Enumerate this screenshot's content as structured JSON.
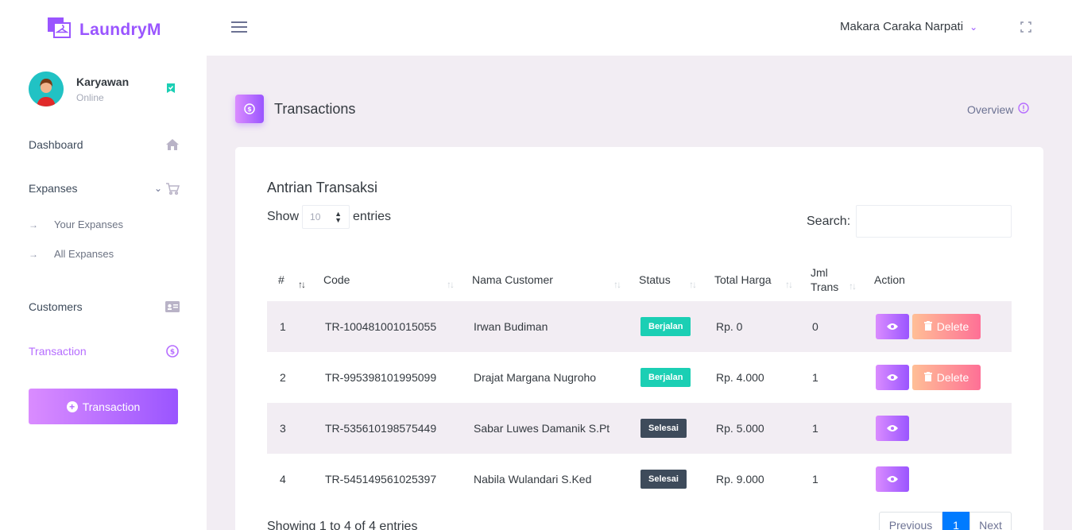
{
  "brand": {
    "name": "LaundryM"
  },
  "header": {
    "user_name": "Makara Caraka Narpati"
  },
  "sidebar": {
    "profile": {
      "name": "Karyawan",
      "status": "Online"
    },
    "items": [
      {
        "label": "Dashboard",
        "icon": "home-icon"
      },
      {
        "label": "Expanses",
        "icon": "cart-icon"
      },
      {
        "label": "Customers",
        "icon": "id-card-icon"
      },
      {
        "label": "Transaction",
        "icon": "dollar-circle-icon"
      }
    ],
    "sub_items": [
      {
        "label": "Your Expanses"
      },
      {
        "label": "All Expanses"
      }
    ],
    "button_label": "Transaction"
  },
  "page": {
    "title": "Transactions",
    "overview_label": "Overview"
  },
  "card": {
    "title": "Antrian Transaksi",
    "show_label": "Show",
    "entries_label": "entries",
    "length_value": "10",
    "search_label": "Search:",
    "columns": [
      "#",
      "Code",
      "Nama Customer",
      "Status",
      "Total Harga",
      "Jml Trans",
      "Action"
    ],
    "rows": [
      {
        "no": "1",
        "code": "TR-100481001015055",
        "customer": "Irwan Budiman",
        "status": "Berjalan",
        "total": "Rp. 0",
        "jml": "0",
        "delete_label": "Delete"
      },
      {
        "no": "2",
        "code": "TR-995398101995099",
        "customer": "Drajat Margana Nugroho",
        "status": "Berjalan",
        "total": "Rp. 4.000",
        "jml": "1",
        "delete_label": "Delete"
      },
      {
        "no": "3",
        "code": "TR-535610198575449",
        "customer": "Sabar Luwes Damanik S.Pt",
        "status": "Selesai",
        "total": "Rp. 5.000",
        "jml": "1"
      },
      {
        "no": "4",
        "code": "TR-545149561025397",
        "customer": "Nabila Wulandari S.Ked",
        "status": "Selesai",
        "total": "Rp. 9.000",
        "jml": "1"
      }
    ],
    "info": "Showing 1 to 4 of 4 entries",
    "pagination": {
      "previous": "Previous",
      "current": "1",
      "next": "Next"
    }
  },
  "colors": {
    "accent": "#9a55ff",
    "success": "#1bcfb4",
    "dark": "#3e4b5b",
    "danger": "#fe7096",
    "primary": "#007bff"
  }
}
